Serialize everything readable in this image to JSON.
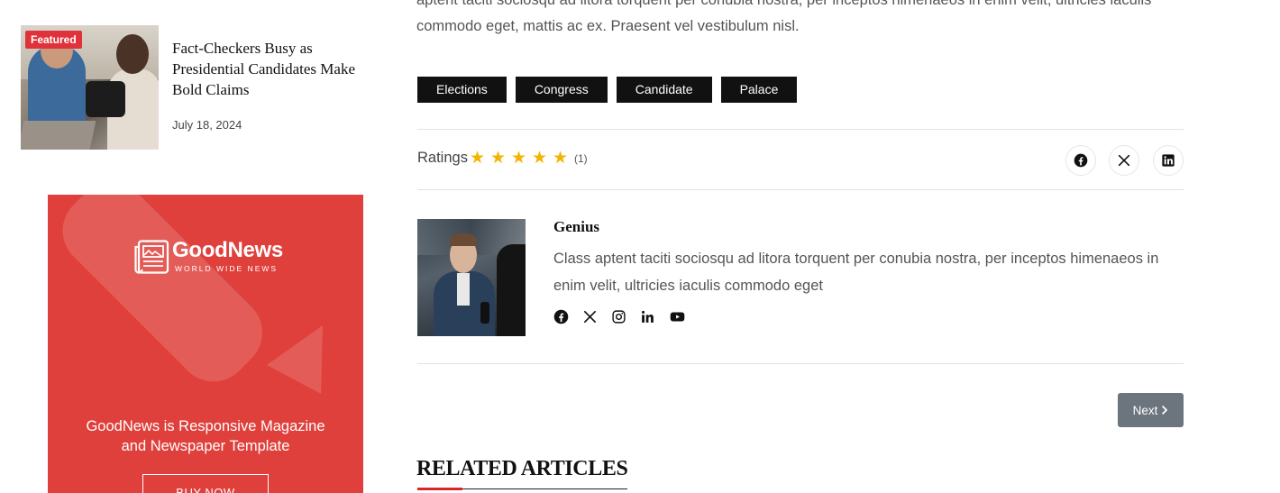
{
  "sidebar": {
    "featured_post": {
      "badge": "Featured",
      "title": "Fact-Checkers Busy as Presidential Candidates Make Bold Claims",
      "date": "July 18, 2024"
    },
    "ad": {
      "brand": "GoodNews",
      "tagline": "WORLD WIDE NEWS",
      "text_line1": "GoodNews is Responsive Magazine",
      "text_line2": "and Newspaper Template",
      "button": "BUY NOW",
      "color": "#e0403b"
    }
  },
  "article": {
    "body_tail_line1": "aptent taciti sociosqu ad litora torquent per conubia nostra, per inceptos himenaeos in enim velit, ultricies iaculis",
    "body_tail_line2": "commodo eget, mattis ac ex. Praesent vel vestibulum nisl.",
    "tags": [
      "Elections",
      "Congress",
      "Candidate",
      "Palace"
    ],
    "ratings": {
      "label": "Ratings",
      "stars": 5,
      "count": "(1)",
      "star_color": "#f5b301"
    },
    "share_icons": [
      "facebook-icon",
      "x-icon",
      "linkedin-icon"
    ],
    "author": {
      "name": "Genius",
      "bio": "Class aptent taciti sociosqu ad litora torquent per conubia nostra, per inceptos himenaeos in enim velit, ultricies iaculis commodo eget",
      "social_icons": [
        "facebook-icon",
        "x-icon",
        "instagram-icon",
        "linkedin-icon",
        "youtube-icon"
      ]
    },
    "pagination": {
      "next_label": "Next"
    },
    "related_heading": "RELATED ARTICLES",
    "accent_color": "#d62828"
  }
}
